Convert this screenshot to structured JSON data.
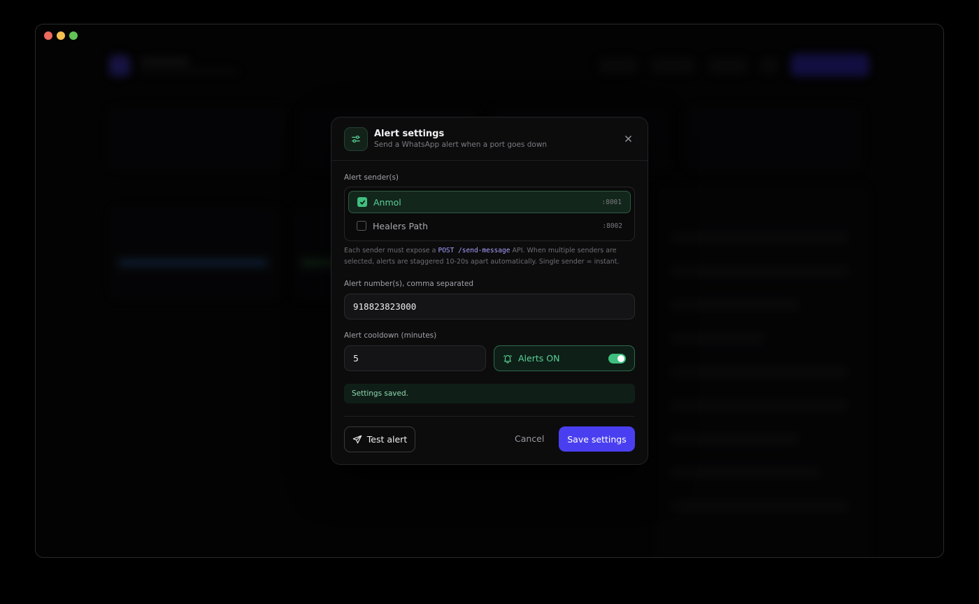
{
  "modal": {
    "title": "Alert settings",
    "subtitle": "Send a WhatsApp alert when a port goes down",
    "icon": "sliders-icon",
    "close_icon": "close-icon"
  },
  "senders": {
    "label": "Alert sender(s)",
    "items": [
      {
        "name": "Anmol",
        "port": ":8001",
        "checked": true
      },
      {
        "name": "Healers Path",
        "port": ":8002",
        "checked": false
      }
    ],
    "note_prefix": "Each sender must expose a",
    "note_code": "POST /send-message",
    "note_suffix": "API. When multiple senders are selected, alerts are staggered 10-20s apart automatically. Single sender = instant."
  },
  "numbers": {
    "label": "Alert number(s), comma separated",
    "value": "918823823000"
  },
  "cooldown": {
    "label": "Alert cooldown (minutes)",
    "value": "5"
  },
  "alerts_toggle": {
    "label": "Alerts ON",
    "on": true,
    "icon": "bell-icon"
  },
  "status": {
    "message": "Settings saved."
  },
  "actions": {
    "test_label": "Test alert",
    "test_icon": "send-icon",
    "cancel_label": "Cancel",
    "save_label": "Save settings"
  },
  "colors": {
    "accent": "#4a3ff0",
    "success": "#3fbf7f",
    "background": "#0c0c0d"
  }
}
